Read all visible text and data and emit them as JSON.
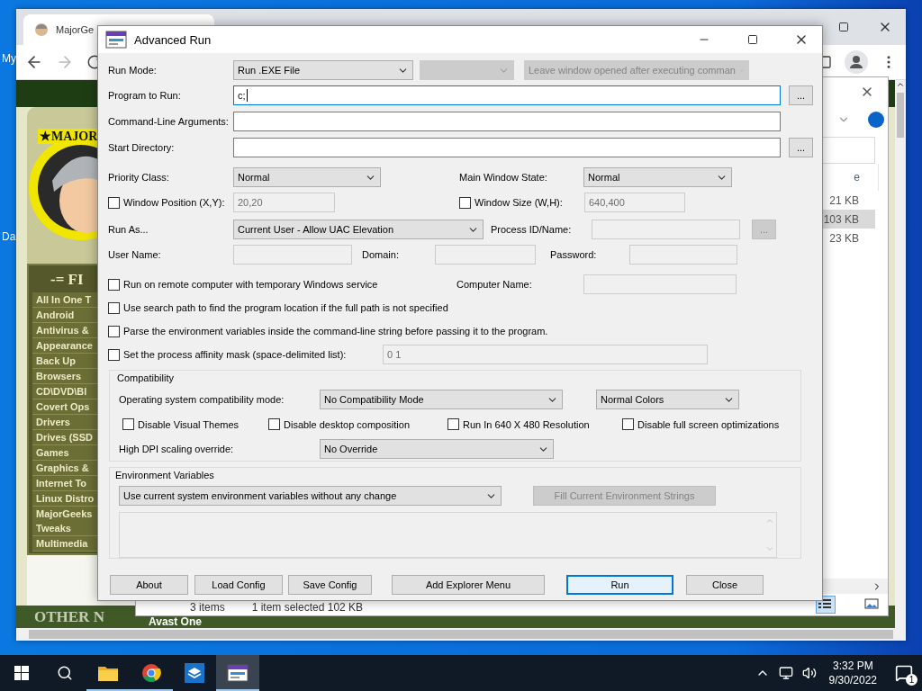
{
  "desktop": {
    "icons": [
      "My",
      "Da"
    ]
  },
  "browser": {
    "tab_title": "MajorGe",
    "site": {
      "logo_text": "★MAJOR",
      "menu_heading": "-= FI",
      "menu_items": [
        "All In One T",
        "Android",
        "Antivirus &",
        "Appearance",
        "Back Up",
        "Browsers",
        "CD\\DVD\\Bl",
        "Covert Ops",
        "Drivers",
        "Drives (SSD",
        "Games",
        "Graphics &",
        "Internet To",
        "Linux Distro",
        "MajorGeeks Tweaks",
        "Multimedia"
      ],
      "footer_heading": "OTHER N",
      "ad_text": "Avast One"
    }
  },
  "explorer": {
    "column_header": "e",
    "rows": [
      {
        "size": "21 KB",
        "selected": false
      },
      {
        "size": "103 KB",
        "selected": true
      },
      {
        "size": "23 KB",
        "selected": false
      }
    ],
    "status": [
      "3 items",
      "1 item selected  102 KB"
    ]
  },
  "dialog": {
    "title": "Advanced Run",
    "run_mode": {
      "label": "Run Mode:",
      "value": "Run .EXE File",
      "secondary": {
        "disabled": true
      },
      "tertiary": {
        "value": "Leave window opened after executing comman",
        "disabled": true
      }
    },
    "program": {
      "label": "Program to Run:",
      "value": "c;",
      "focused": true,
      "browse": "..."
    },
    "arguments": {
      "label": "Command-Line Arguments:"
    },
    "start_directory": {
      "label": "Start Directory:",
      "browse": "..."
    },
    "priority": {
      "label": "Priority Class:",
      "value": "Normal"
    },
    "window_state": {
      "label": "Main Window State:",
      "value": "Normal"
    },
    "window_position": {
      "label": "Window Position (X,Y):",
      "checked": false,
      "value": "20,20",
      "disabled": true
    },
    "window_size": {
      "label": "Window Size (W,H):",
      "checked": false,
      "value": "640,400",
      "disabled": true
    },
    "run_as": {
      "label": "Run As...",
      "value": "Current User - Allow UAC Elevation"
    },
    "process": {
      "label": "Process ID/Name:",
      "disabled": true,
      "browse": "..."
    },
    "user_name": {
      "label": "User Name:",
      "disabled": true
    },
    "domain": {
      "label": "Domain:",
      "disabled": true
    },
    "password": {
      "label": "Password:",
      "disabled": true
    },
    "remote": {
      "label": "Run on remote computer with temporary Windows service",
      "checked": false
    },
    "computer_name": {
      "label": "Computer Name:",
      "disabled": true
    },
    "search_path": {
      "label": "Use search path to find the program location if the full path is not specified",
      "checked": false
    },
    "parse_env": {
      "label": "Parse the environment variables inside the command-line string before passing it to the program.",
      "checked": false
    },
    "affinity": {
      "label": "Set the process affinity mask (space-delimited list):",
      "checked": false,
      "value": "0 1",
      "disabled": true
    },
    "compatibility": {
      "title": "Compatibility",
      "os_mode": {
        "label": "Operating system compatibility mode:",
        "value": "No Compatibility Mode"
      },
      "colors": {
        "value": "Normal Colors"
      },
      "options": [
        {
          "label": "Disable Visual Themes",
          "checked": false
        },
        {
          "label": "Disable desktop composition",
          "checked": false
        },
        {
          "label": "Run In 640 X 480 Resolution",
          "checked": false
        },
        {
          "label": "Disable full screen optimizations",
          "checked": false
        }
      ],
      "dpi": {
        "label": "High DPI scaling override:",
        "value": "No Override"
      }
    },
    "environment": {
      "title": "Environment Variables",
      "mode": {
        "value": "Use current system environment variables without any change"
      },
      "fill_button": {
        "label": "Fill Current Environment Strings",
        "disabled": true
      }
    },
    "buttons": [
      {
        "label": "About",
        "default": false
      },
      {
        "label": "Load Config",
        "default": false
      },
      {
        "label": "Save Config",
        "default": false
      },
      {
        "label": "Add Explorer Menu",
        "default": false
      },
      {
        "label": "Run",
        "default": true
      },
      {
        "label": "Close",
        "default": false
      }
    ]
  },
  "taskbar": {
    "apps": [
      {
        "kind": "folder",
        "running": true,
        "active": false
      },
      {
        "kind": "browser",
        "running": true,
        "active": false
      },
      {
        "kind": "box",
        "running": false,
        "active": false
      },
      {
        "kind": "runner",
        "running": true,
        "active": true
      }
    ],
    "time": "3:32 PM",
    "date": "9/30/2022",
    "notifications": "1"
  }
}
